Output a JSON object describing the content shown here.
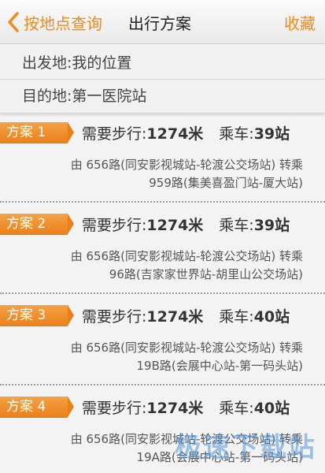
{
  "nav": {
    "back_label": "按地点查询",
    "title": "出行方案",
    "favorite_label": "收藏"
  },
  "route": {
    "from_label": "出发地:",
    "from_value": "我的位置",
    "to_label": "目的地:",
    "to_value": "第一医院站"
  },
  "plans": [
    {
      "tag": "方案 1",
      "walk_label": "需要步行:",
      "walk_value": "1274米",
      "ride_label": "乘车:",
      "ride_value": "39站",
      "line1": "由 656路(同安影视城站-轮渡公交场站) 转乘",
      "line2": "959路(集美喜盈门站-厦大站)"
    },
    {
      "tag": "方案 2",
      "walk_label": "需要步行:",
      "walk_value": "1274米",
      "ride_label": "乘车:",
      "ride_value": "39站",
      "line1": "由 656路(同安影视城站-轮渡公交场站) 转乘",
      "line2": "96路(吉家家世界站-胡里山公交场站)"
    },
    {
      "tag": "方案 3",
      "walk_label": "需要步行:",
      "walk_value": "1274米",
      "ride_label": "乘车:",
      "ride_value": "40站",
      "line1": "由 656路(同安影视城站-轮渡公交场站) 转乘",
      "line2": "19B路(会展中心站-第一码头站)"
    },
    {
      "tag": "方案 4",
      "walk_label": "需要步行:",
      "walk_value": "1274米",
      "ride_label": "乘车:",
      "ride_value": "40站",
      "line1": "由 656路(同安影视城站-轮渡公交场站) 转乘",
      "line2": "19A路(会展中心站-第一码头站)"
    }
  ],
  "watermark": "极速下载站",
  "colors": {
    "accent": "#f08a1c",
    "tag_gradient_top": "#f4a248",
    "tag_gradient_bottom": "#ea7f18"
  }
}
